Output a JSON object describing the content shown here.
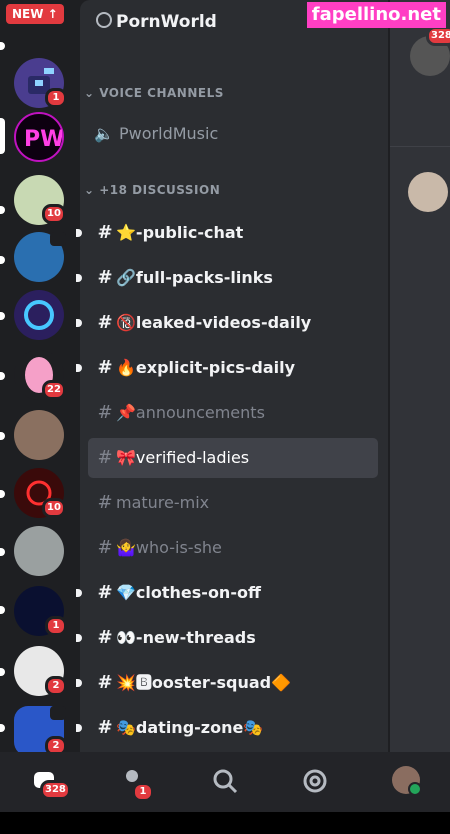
{
  "new_button": "NEW",
  "watermark": "fapellino.net",
  "server": {
    "name": "PornWorld",
    "voice_category": "VOICE CHANNELS",
    "voice_channel": "PworldMusic",
    "category": "+18 DISCUSSION",
    "channels": [
      {
        "label": "⭐-public-chat",
        "state": "unread"
      },
      {
        "label": "🔗full-packs-links",
        "state": "unread"
      },
      {
        "label": "🔞leaked-videos-daily",
        "state": "unread"
      },
      {
        "label": "🔥explicit-pics-daily",
        "state": "unread"
      },
      {
        "label": "📌announcements",
        "state": "muted"
      },
      {
        "label": "🎀verified-ladies",
        "state": "selected"
      },
      {
        "label": "mature-mix",
        "state": "muted"
      },
      {
        "label": "🤷‍♀️who-is-she",
        "state": "muted"
      },
      {
        "label": "💎clothes-on-off",
        "state": "unread"
      },
      {
        "label": "👀-new-threads",
        "state": "unread"
      },
      {
        "label": "💥🅱ooster-squad🔶",
        "state": "unread"
      },
      {
        "label": "🎭dating-zone🎭",
        "state": "unread"
      }
    ]
  },
  "server_badges": [
    "1",
    "10",
    "22",
    "10",
    "1",
    "2",
    "2"
  ],
  "main": {
    "member_badge": "328"
  },
  "nav": {
    "home_badge": "328",
    "friends_badge": "1"
  },
  "colors": {
    "accent": "#e23a3f",
    "watermark": "#ff3fc4",
    "rail": "#1e1f22",
    "channels": "#2b2d31"
  }
}
